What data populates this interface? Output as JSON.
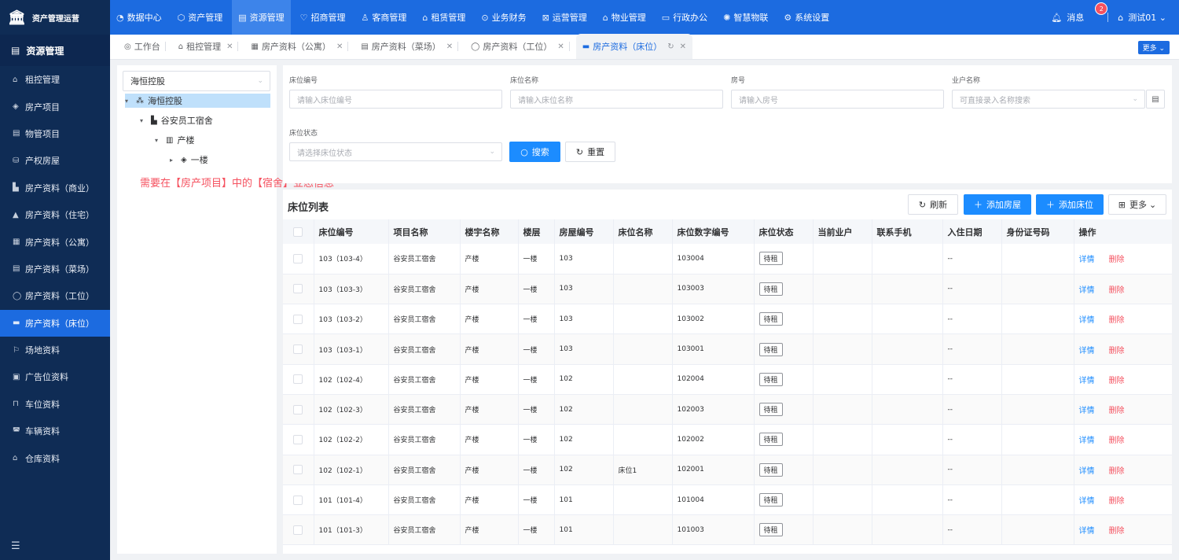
{
  "app": {
    "title": "资产管理运营"
  },
  "top_menu": [
    {
      "icon": "◔",
      "label": "数据中心"
    },
    {
      "icon": "⬡",
      "label": "资产管理"
    },
    {
      "icon": "▤",
      "label": "资源管理",
      "active": true
    },
    {
      "icon": "♡",
      "label": "招商管理"
    },
    {
      "icon": "♙",
      "label": "客商管理"
    },
    {
      "icon": "⌂",
      "label": "租赁管理"
    },
    {
      "icon": "⊙",
      "label": "业务财务"
    },
    {
      "icon": "⊠",
      "label": "运营管理"
    },
    {
      "icon": "⌂",
      "label": "物业管理"
    },
    {
      "icon": "▭",
      "label": "行政办公"
    },
    {
      "icon": "✺",
      "label": "智慧物联"
    },
    {
      "icon": "⚙",
      "label": "系统设置"
    }
  ],
  "top_right": {
    "message_label": "消息",
    "message_count": "2",
    "user_label": "测试01",
    "user_caret": "⌄"
  },
  "sidebar": {
    "title": "资源管理",
    "items": [
      {
        "icon": "⌂",
        "label": "租控管理"
      },
      {
        "icon": "◈",
        "label": "房产项目"
      },
      {
        "icon": "▤",
        "label": "物管项目"
      },
      {
        "icon": "⛁",
        "label": "产权房屋"
      },
      {
        "icon": "▙",
        "label": "房产资料（商业）"
      },
      {
        "icon": "▲",
        "label": "房产资料（住宅）"
      },
      {
        "icon": "▦",
        "label": "房产资料（公寓）"
      },
      {
        "icon": "▤",
        "label": "房产资料（菜场）"
      },
      {
        "icon": "◯",
        "label": "房产资料（工位）"
      },
      {
        "icon": "▬",
        "label": "房产资料（床位）",
        "active": true
      },
      {
        "icon": "⚐",
        "label": "场地资料"
      },
      {
        "icon": "▣",
        "label": "广告位资料"
      },
      {
        "icon": "⊓",
        "label": "车位资料"
      },
      {
        "icon": "◚",
        "label": "车辆资料"
      },
      {
        "icon": "⌂",
        "label": "仓库资料"
      }
    ],
    "footer_icon": "☰"
  },
  "tabs": [
    {
      "icon": "◎",
      "label": "工作台",
      "closable": false
    },
    {
      "icon": "⌂",
      "label": "租控管理",
      "closable": true
    },
    {
      "icon": "▦",
      "label": "房产资料（公寓）",
      "closable": true
    },
    {
      "icon": "▤",
      "label": "房产资料（菜场）",
      "closable": true
    },
    {
      "icon": "◯",
      "label": "房产资料（工位）",
      "closable": true
    },
    {
      "icon": "▬",
      "label": "房产资料（床位）",
      "closable": true,
      "active": true
    }
  ],
  "tabs_more": "更多 ⌄",
  "tree": {
    "select_value": "海恒控股",
    "nodes": [
      {
        "label": "海恒控股",
        "icon": "⁂",
        "twist": "▾",
        "level": 0,
        "selected": true
      },
      {
        "label": "谷安员工宿舍",
        "icon": "▙",
        "twist": "▾",
        "level": 1
      },
      {
        "label": "产楼",
        "icon": "▥",
        "twist": "▾",
        "level": 2
      },
      {
        "label": "一楼",
        "icon": "◈",
        "twist": "▸",
        "level": 3
      }
    ]
  },
  "note": "需要在【房产项目】中的【宿舍】业态信息",
  "search": {
    "fields": [
      {
        "label": "床位编号",
        "placeholder": "请输入床位编号"
      },
      {
        "label": "床位名称",
        "placeholder": "请输入床位名称"
      },
      {
        "label": "房号",
        "placeholder": "请输入房号"
      },
      {
        "label": "业户名称",
        "placeholder": "可直接录入名称搜索"
      },
      {
        "label": "床位状态",
        "placeholder": "请选择床位状态"
      }
    ],
    "search_label": "搜索",
    "reset_label": "重置"
  },
  "list": {
    "title": "床位列表",
    "refresh_label": "刷新",
    "add_room_label": "添加房屋",
    "add_bed_label": "添加床位",
    "more_label": "更多",
    "columns": [
      "床位编号",
      "项目名称",
      "楼宇名称",
      "楼层",
      "房屋编号",
      "床位名称",
      "床位数字编号",
      "床位状态",
      "当前业户",
      "联系手机",
      "入住日期",
      "身份证号码",
      "操作"
    ],
    "rows": [
      {
        "code": "103（103-4）",
        "project": "谷安员工宿舍",
        "building": "产楼",
        "floor": "一楼",
        "room": "103",
        "name": "",
        "num": "103004",
        "status": "待租",
        "tenant": "",
        "phone": "",
        "date": "--",
        "idcard": ""
      },
      {
        "code": "103（103-3）",
        "project": "谷安员工宿舍",
        "building": "产楼",
        "floor": "一楼",
        "room": "103",
        "name": "",
        "num": "103003",
        "status": "待租",
        "tenant": "",
        "phone": "",
        "date": "--",
        "idcard": ""
      },
      {
        "code": "103（103-2）",
        "project": "谷安员工宿舍",
        "building": "产楼",
        "floor": "一楼",
        "room": "103",
        "name": "",
        "num": "103002",
        "status": "待租",
        "tenant": "",
        "phone": "",
        "date": "--",
        "idcard": ""
      },
      {
        "code": "103（103-1）",
        "project": "谷安员工宿舍",
        "building": "产楼",
        "floor": "一楼",
        "room": "103",
        "name": "",
        "num": "103001",
        "status": "待租",
        "tenant": "",
        "phone": "",
        "date": "--",
        "idcard": ""
      },
      {
        "code": "102（102-4）",
        "project": "谷安员工宿舍",
        "building": "产楼",
        "floor": "一楼",
        "room": "102",
        "name": "",
        "num": "102004",
        "status": "待租",
        "tenant": "",
        "phone": "",
        "date": "--",
        "idcard": ""
      },
      {
        "code": "102（102-3）",
        "project": "谷安员工宿舍",
        "building": "产楼",
        "floor": "一楼",
        "room": "102",
        "name": "",
        "num": "102003",
        "status": "待租",
        "tenant": "",
        "phone": "",
        "date": "--",
        "idcard": ""
      },
      {
        "code": "102（102-2）",
        "project": "谷安员工宿舍",
        "building": "产楼",
        "floor": "一楼",
        "room": "102",
        "name": "",
        "num": "102002",
        "status": "待租",
        "tenant": "",
        "phone": "",
        "date": "--",
        "idcard": ""
      },
      {
        "code": "102（102-1）",
        "project": "谷安员工宿舍",
        "building": "产楼",
        "floor": "一楼",
        "room": "102",
        "name": "床位1",
        "num": "102001",
        "status": "待租",
        "tenant": "",
        "phone": "",
        "date": "--",
        "idcard": ""
      },
      {
        "code": "101（101-4）",
        "project": "谷安员工宿舍",
        "building": "产楼",
        "floor": "一楼",
        "room": "101",
        "name": "",
        "num": "101004",
        "status": "待租",
        "tenant": "",
        "phone": "",
        "date": "--",
        "idcard": ""
      },
      {
        "code": "101（101-3）",
        "project": "谷安员工宿舍",
        "building": "产楼",
        "floor": "一楼",
        "room": "101",
        "name": "",
        "num": "101003",
        "status": "待租",
        "tenant": "",
        "phone": "",
        "date": "--",
        "idcard": ""
      }
    ],
    "detail_label": "详情",
    "delete_label": "删除"
  },
  "colors": {
    "primary": "#1c6be0",
    "sidebar": "#0f2c55",
    "danger": "#f5515f",
    "link": "#1c8cff"
  }
}
